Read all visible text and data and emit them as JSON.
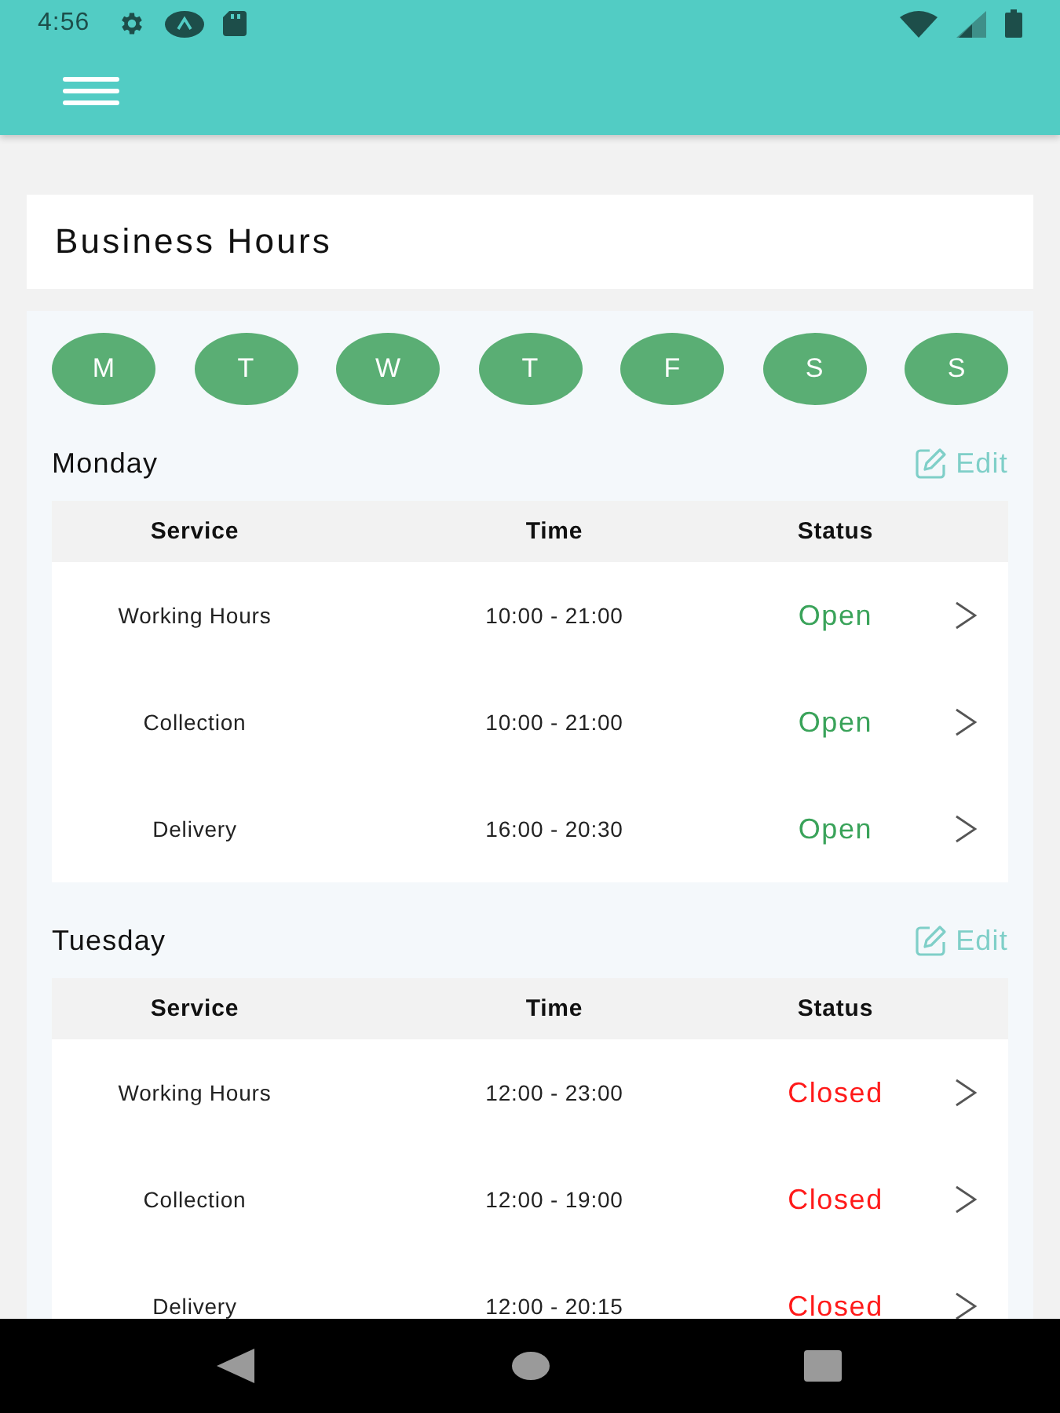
{
  "status_bar": {
    "time": "4:56"
  },
  "title": "Business Hours",
  "day_buttons": [
    "M",
    "T",
    "W",
    "T",
    "F",
    "S",
    "S"
  ],
  "schedules": [
    {
      "day": "Monday",
      "edit_label": "Edit",
      "columns": [
        "Service",
        "Time",
        "Status"
      ],
      "rows": [
        {
          "service": "Working Hours",
          "time": "10:00 - 21:00",
          "status": "Open",
          "open": true
        },
        {
          "service": "Collection",
          "time": "10:00 - 21:00",
          "status": "Open",
          "open": true
        },
        {
          "service": "Delivery",
          "time": "16:00 - 20:30",
          "status": "Open",
          "open": true
        }
      ]
    },
    {
      "day": "Tuesday",
      "edit_label": "Edit",
      "columns": [
        "Service",
        "Time",
        "Status"
      ],
      "rows": [
        {
          "service": "Working Hours",
          "time": "12:00 - 23:00",
          "status": "Closed",
          "open": false
        },
        {
          "service": "Collection",
          "time": "12:00 - 19:00",
          "status": "Closed",
          "open": false
        },
        {
          "service": "Delivery",
          "time": "12:00 - 20:15",
          "status": "Closed",
          "open": false
        }
      ]
    }
  ]
}
